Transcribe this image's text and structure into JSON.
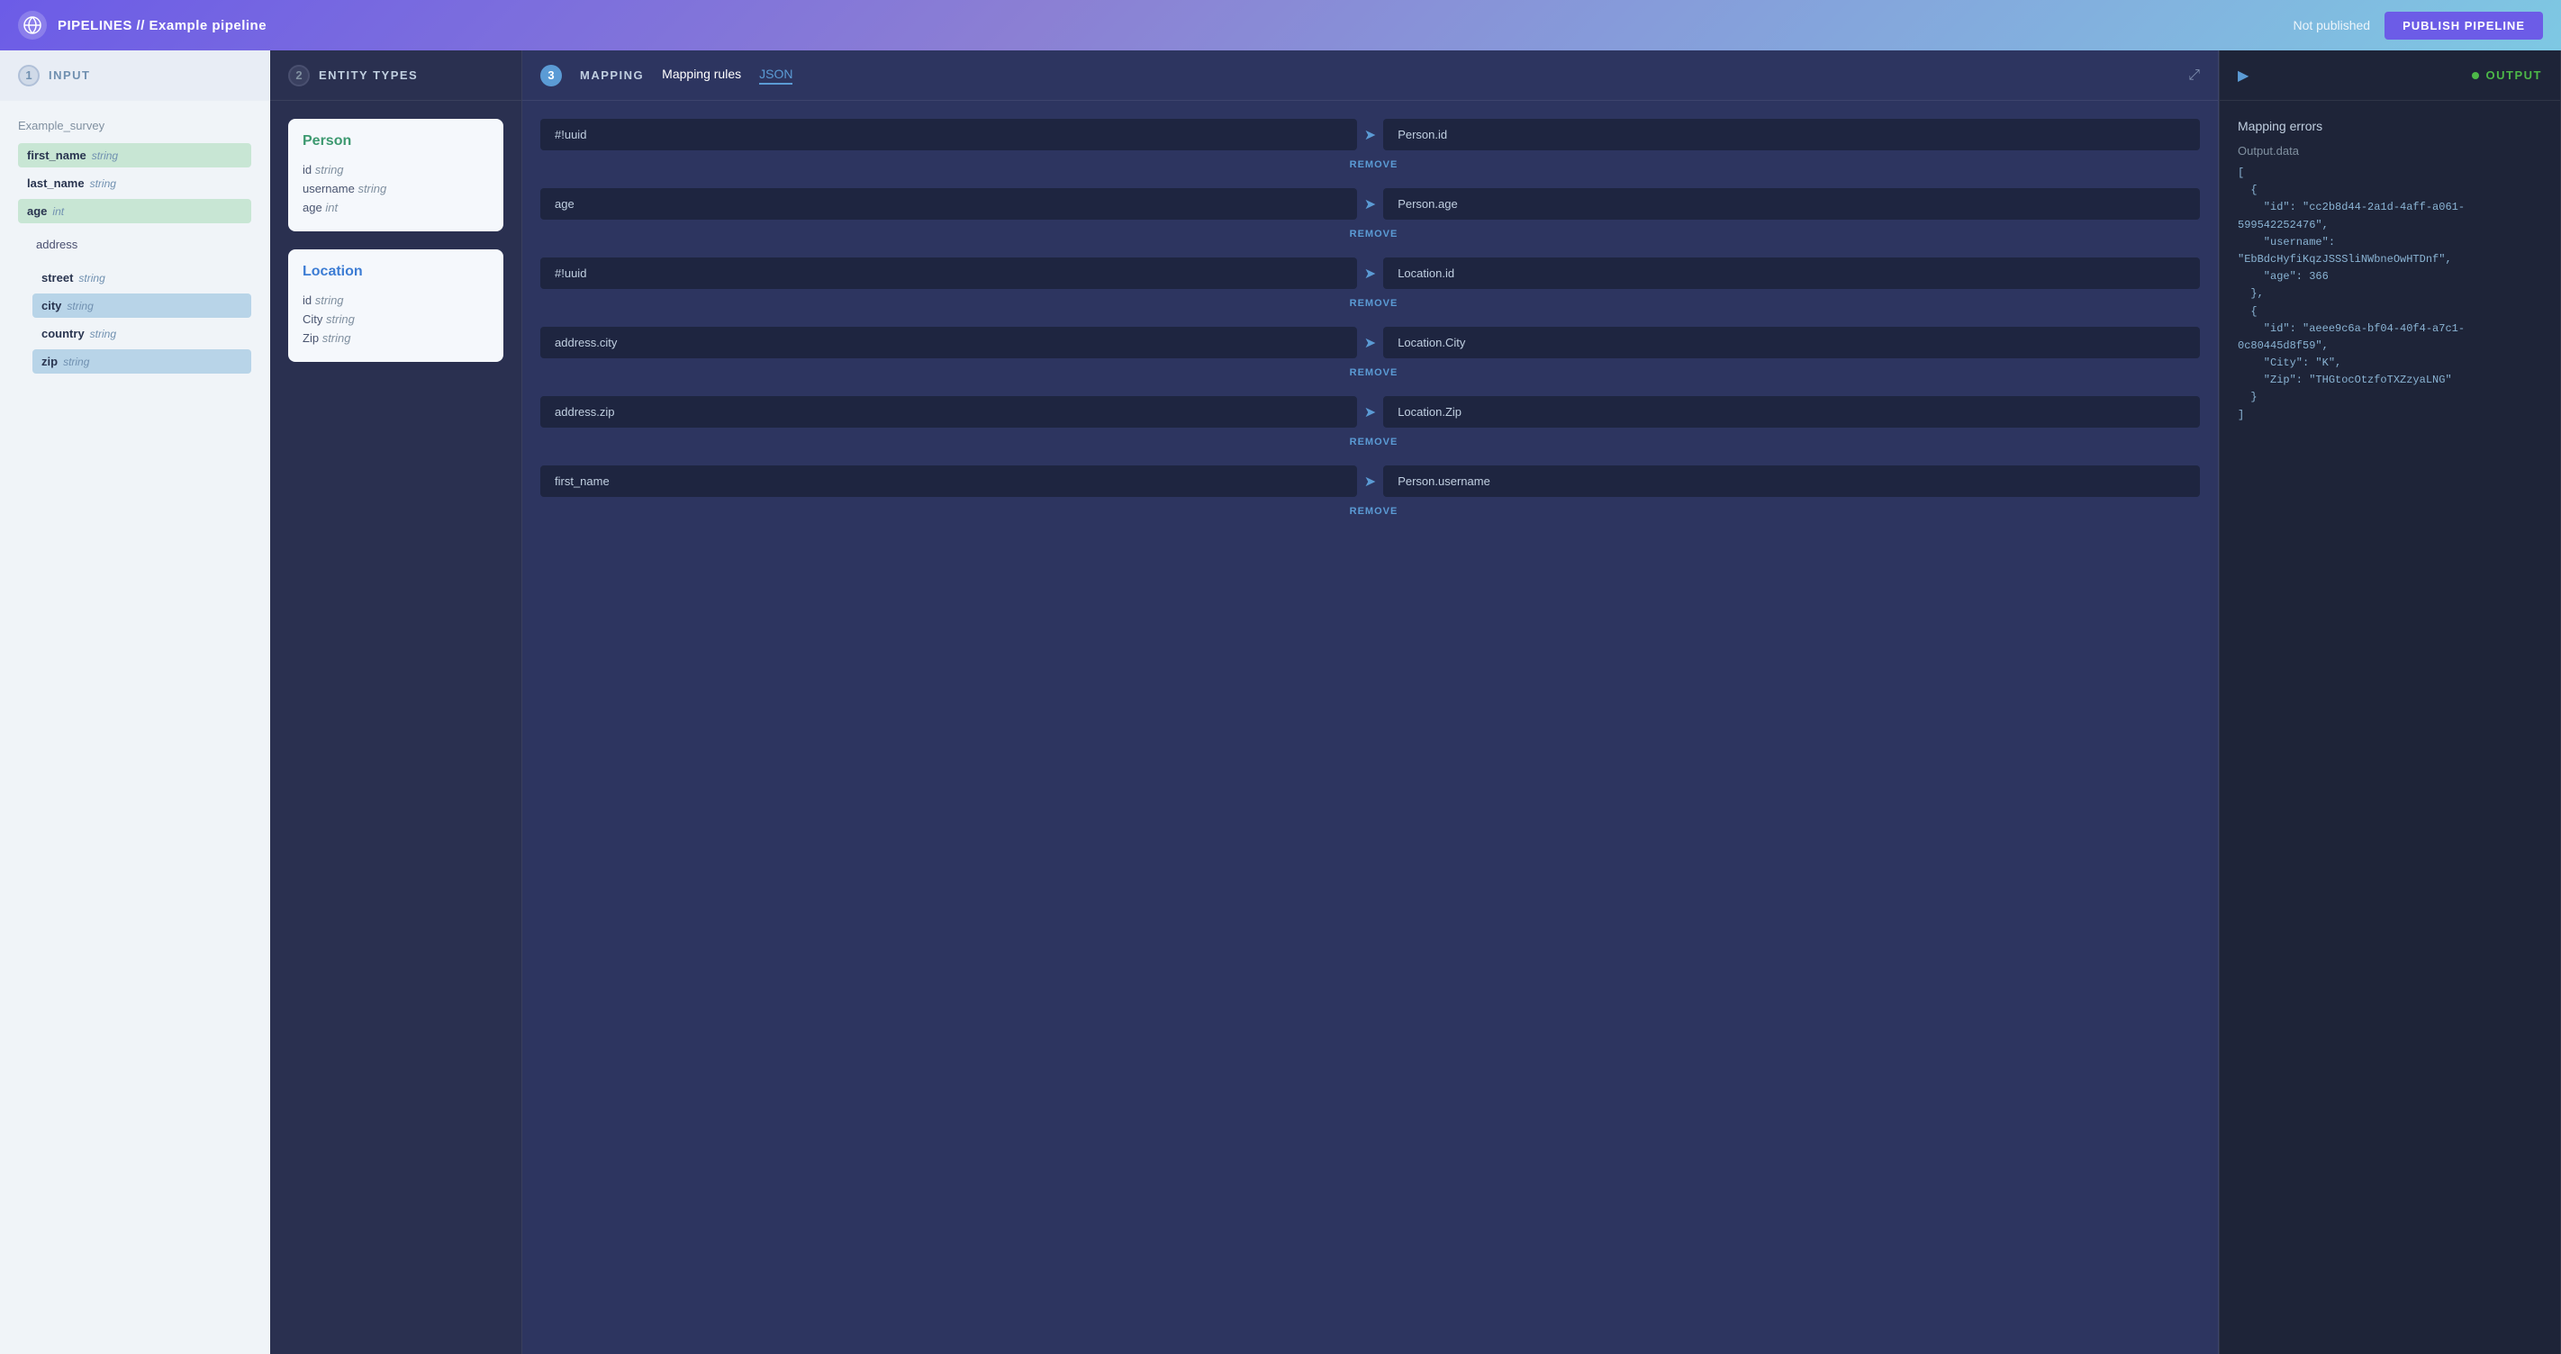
{
  "header": {
    "logo_text": "🏀",
    "title": "PIPELINES // Example pipeline",
    "not_published_label": "Not published",
    "publish_label": "PUBLISH PIPELINE"
  },
  "steps": {
    "input": {
      "number": "1",
      "label": "INPUT"
    },
    "entity_types": {
      "number": "2",
      "label": "ENTITY TYPES"
    },
    "mapping": {
      "number": "3",
      "label": "MAPPING"
    },
    "output": {
      "label": "OUTPUT"
    }
  },
  "input": {
    "survey_name": "Example_survey",
    "fields": [
      {
        "name": "first_name",
        "type": "string",
        "highlight": "green",
        "indent": false
      },
      {
        "name": "last_name",
        "type": "string",
        "highlight": "none",
        "indent": false
      },
      {
        "name": "age",
        "type": "int",
        "highlight": "green",
        "indent": false
      },
      {
        "name": "address",
        "type": "",
        "highlight": "none",
        "indent": false,
        "group": true
      },
      {
        "name": "street",
        "type": "string",
        "highlight": "none",
        "indent": true
      },
      {
        "name": "city",
        "type": "string",
        "highlight": "blue",
        "indent": true
      },
      {
        "name": "country",
        "type": "string",
        "highlight": "none",
        "indent": true
      },
      {
        "name": "zip",
        "type": "string",
        "highlight": "blue",
        "indent": true
      }
    ]
  },
  "entities": [
    {
      "title": "Person",
      "color": "person",
      "fields": [
        {
          "name": "id",
          "type": "string"
        },
        {
          "name": "username",
          "type": "string"
        },
        {
          "name": "age",
          "type": "int"
        }
      ]
    },
    {
      "title": "Location",
      "color": "location",
      "fields": [
        {
          "name": "id",
          "type": "string"
        },
        {
          "name": "City",
          "type": "string"
        },
        {
          "name": "Zip",
          "type": "string"
        }
      ]
    }
  ],
  "mapping": {
    "tab_rules": "Mapping rules",
    "tab_json": "JSON",
    "rules": [
      {
        "source": "#!uuid",
        "target": "Person.id"
      },
      {
        "source": "age",
        "target": "Person.age"
      },
      {
        "source": "#!uuid",
        "target": "Location.id"
      },
      {
        "source": "address.city",
        "target": "Location.City"
      },
      {
        "source": "address.zip",
        "target": "Location.Zip"
      },
      {
        "source": "first_name",
        "target": "Person.username"
      }
    ],
    "remove_label": "REMOVE"
  },
  "output": {
    "section_title": "Mapping errors",
    "subtitle": "Output.data",
    "json_text": "[\n  {\n    \"id\": \"cc2b8d44-2a1d-4aff-a061-\n599542252476\",\n    \"username\":\n\"EbBdcHyfiKqzJSSSliNWbneOwHTDnf\",\n    \"age\": 366\n  },\n  {\n    \"id\": \"aeee9c6a-bf04-40f4-a7c1-\n0c80445d8f59\",\n    \"City\": \"K\",\n    \"Zip\": \"THGtocOtzfoTXZzyaLNG\"\n  }\n]"
  }
}
